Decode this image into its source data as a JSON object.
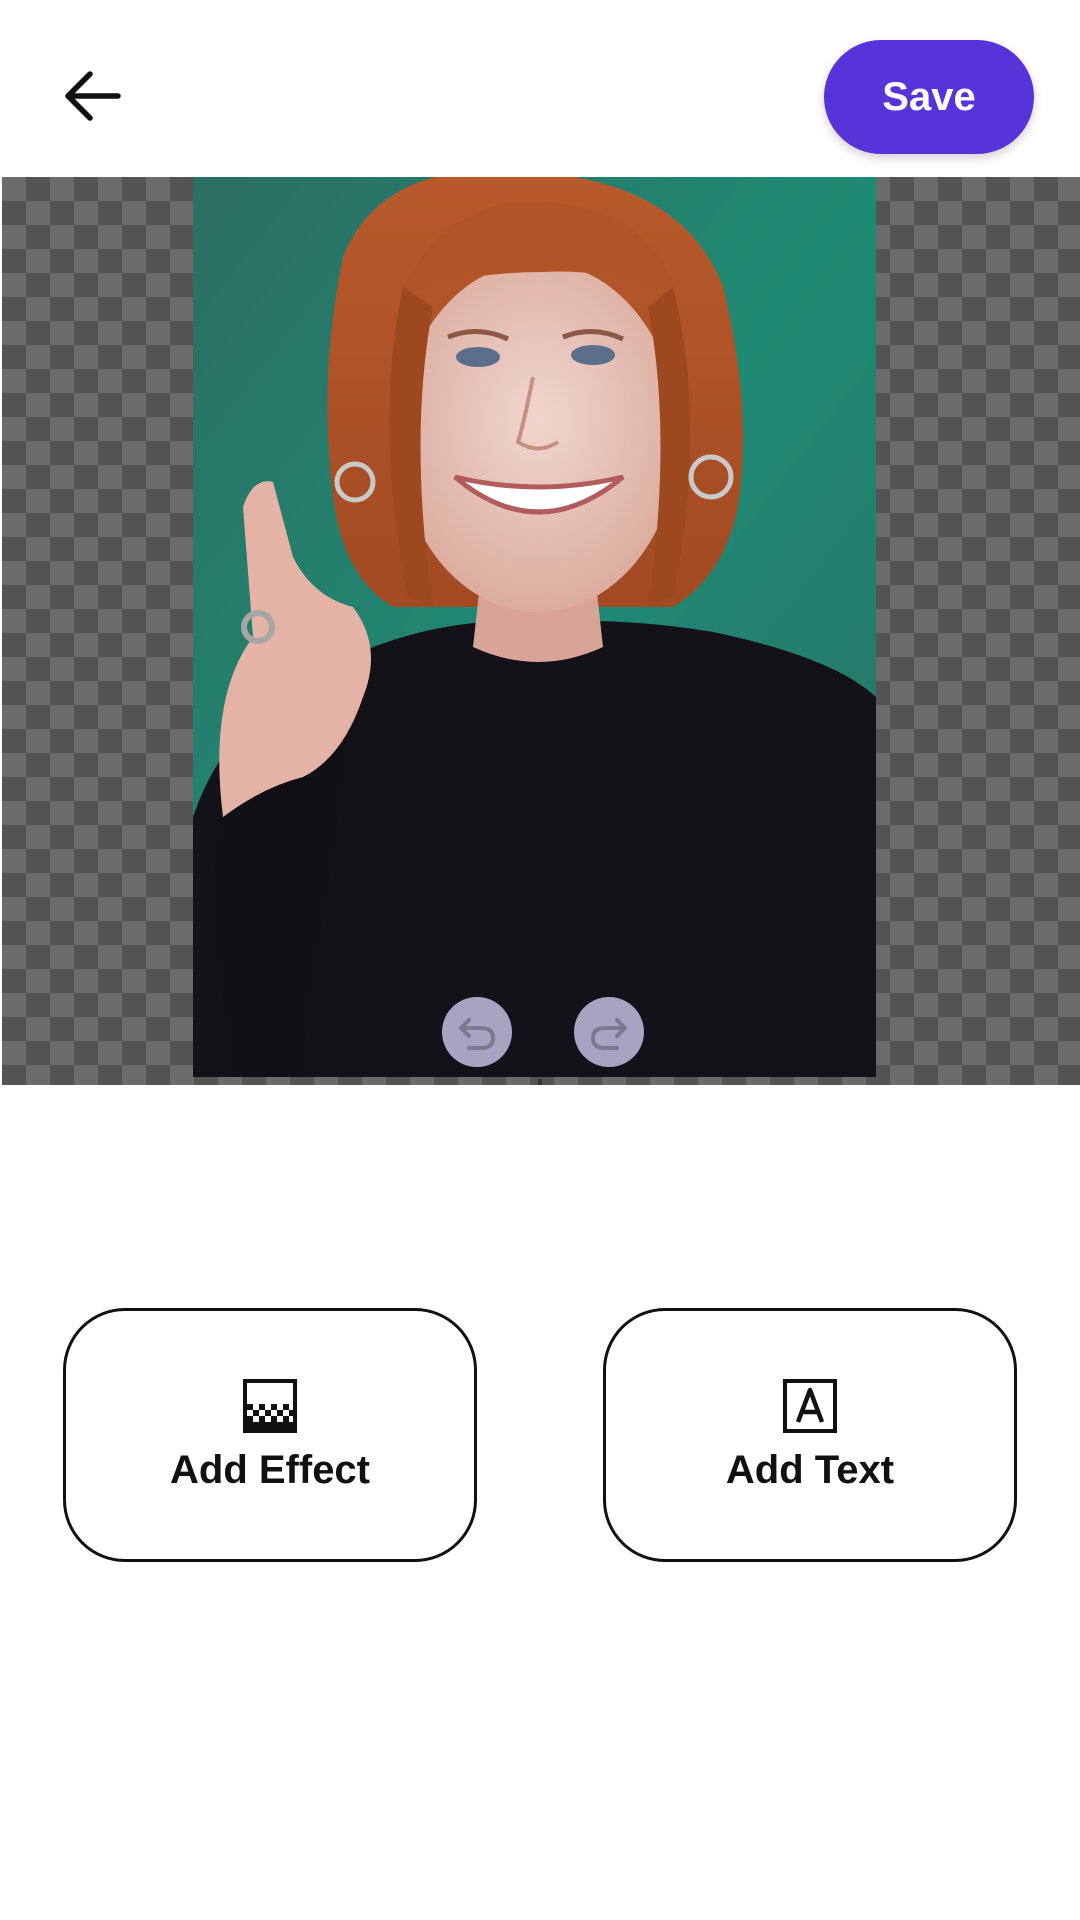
{
  "header": {
    "back_icon": "arrow-left-icon",
    "save_label": "Save",
    "accent_color": "#5634d9"
  },
  "editor": {
    "undo_icon": "undo-icon",
    "redo_icon": "redo-icon"
  },
  "tools": [
    {
      "label": "Add Effect",
      "icon": "effect-gradient-icon"
    },
    {
      "label": "Add Text",
      "icon": "text-box-icon"
    }
  ]
}
